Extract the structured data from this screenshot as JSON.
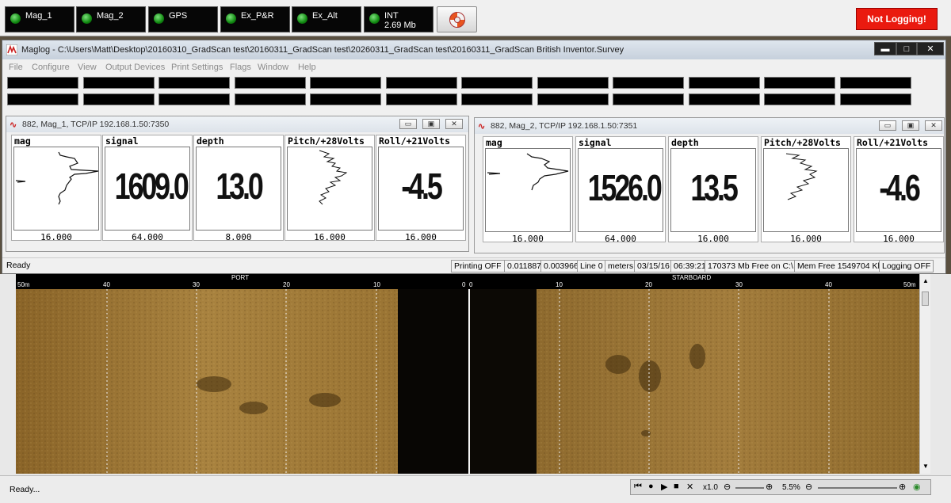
{
  "top_indicators": [
    {
      "label": "Mag_1",
      "sub": ""
    },
    {
      "label": "Mag_2",
      "sub": ""
    },
    {
      "label": "GPS",
      "sub": ""
    },
    {
      "label": "Ex_P&R",
      "sub": ""
    },
    {
      "label": "Ex_Alt",
      "sub": ""
    },
    {
      "label": "INT",
      "sub": "2.69 Mb"
    }
  ],
  "logging_status": "Not Logging!",
  "colors": {
    "logging_red": "#ea1a0f",
    "led_green": "#1fa51f",
    "sonar_amber": "#9c7632"
  },
  "window": {
    "title": "Maglog - C:\\Users\\Matt\\Desktop\\20160310_GradScan test\\20160311_GradScan test\\20260311_GradScan test\\20160311_GradScan British Inventor.Survey",
    "min": "▬",
    "max": "□",
    "close": "✕"
  },
  "menu": [
    "File",
    "Configure",
    "View",
    "Output Devices",
    "Print Settings",
    "Flags",
    "Window",
    "Help"
  ],
  "children": [
    {
      "title": "882, Mag_1, TCP/IP 192.168.1.50:7350",
      "panels": [
        {
          "label": "mag",
          "value": "",
          "scale": "16.000",
          "kind": "trace"
        },
        {
          "label": "signal",
          "value": "1609.0",
          "scale": "64.000",
          "kind": "number"
        },
        {
          "label": "depth",
          "value": "13.0",
          "scale": "8.000",
          "kind": "number"
        },
        {
          "label": "Pitch/+28Volts",
          "value": "",
          "scale": "16.000",
          "kind": "trace"
        },
        {
          "label": "Roll/+21Volts",
          "value": "-4.5",
          "scale": "16.000",
          "kind": "number"
        }
      ]
    },
    {
      "title": "882, Mag_2, TCP/IP 192.168.1.50:7351",
      "panels": [
        {
          "label": "mag",
          "value": "",
          "scale": "16.000",
          "kind": "trace"
        },
        {
          "label": "signal",
          "value": "1526.0",
          "scale": "64.000",
          "kind": "number"
        },
        {
          "label": "depth",
          "value": "13.5",
          "scale": "16.000",
          "kind": "number"
        },
        {
          "label": "Pitch/+28Volts",
          "value": "",
          "scale": "16.000",
          "kind": "trace"
        },
        {
          "label": "Roll/+21Volts",
          "value": "-4.6",
          "scale": "16.000",
          "kind": "number"
        }
      ]
    }
  ],
  "status": {
    "ready": "Ready",
    "printing": "Printing OFF",
    "val1": "0.011887",
    "val2": "0.003966",
    "line": "Line 0",
    "units": "meters",
    "date": "03/15/16",
    "time": "06:39:21",
    "disk": "170373 Mb Free on C:\\",
    "mem": "Mem Free 1549704 Kb",
    "logging": "Logging OFF"
  },
  "sonar": {
    "port_label": "PORT",
    "starboard_label": "STARBOARD",
    "ticks_left": [
      "50m",
      "40",
      "30",
      "20",
      "10",
      "0"
    ],
    "ticks_right": [
      "0",
      "10",
      "20",
      "30",
      "40",
      "50m"
    ],
    "bottom_status": "Ready...",
    "speed": "x1.0",
    "zoom": "5.5%"
  }
}
